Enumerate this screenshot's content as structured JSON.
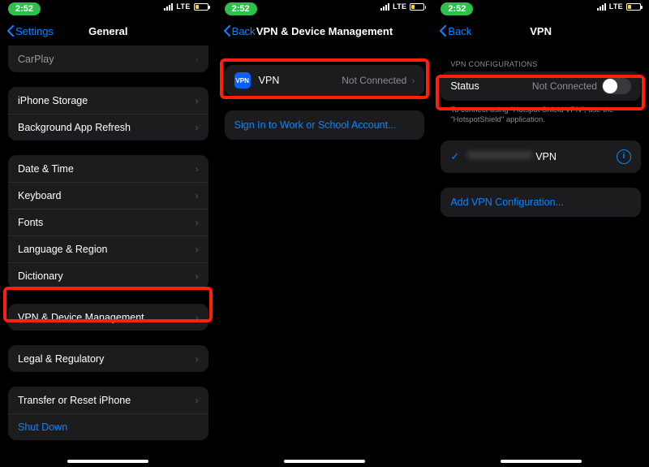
{
  "statusbar": {
    "time": "2:52",
    "network": "LTE"
  },
  "p1": {
    "back": "Settings",
    "title": "General",
    "rows": {
      "carplay": "CarPlay",
      "storage": "iPhone Storage",
      "bgrefresh": "Background App Refresh",
      "datetime": "Date & Time",
      "keyboard": "Keyboard",
      "fonts": "Fonts",
      "langregion": "Language & Region",
      "dictionary": "Dictionary",
      "vpn": "VPN & Device Management",
      "legal": "Legal & Regulatory",
      "transfer": "Transfer or Reset iPhone",
      "shutdown": "Shut Down"
    }
  },
  "p2": {
    "back": "Back",
    "title": "VPN & Device Management",
    "vpn_ico": "VPN",
    "vpn_label": "VPN",
    "vpn_status": "Not Connected",
    "signin": "Sign In to Work or School Account..."
  },
  "p3": {
    "back": "Back",
    "title": "VPN",
    "section": "VPN Configurations",
    "status_label": "Status",
    "status_value": "Not Connected",
    "note": "To connect using \"Hotspot Shield VPN\", use the \"HotspotShield\" application.",
    "sel_suffix": "VPN",
    "info": "i",
    "add": "Add VPN Configuration..."
  }
}
